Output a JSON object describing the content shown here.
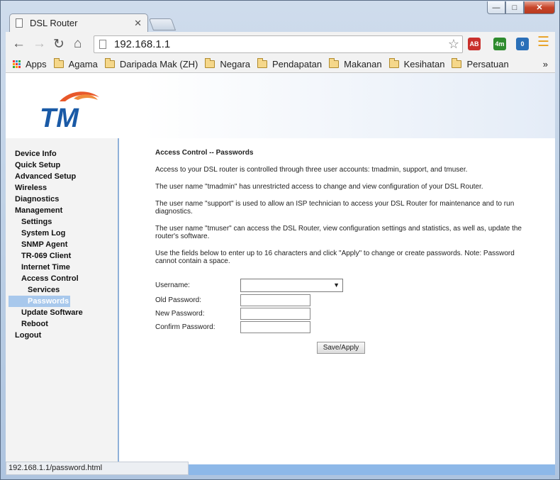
{
  "browser": {
    "tab_title": "DSL Router",
    "url": "192.168.1.1",
    "bookmarks": [
      "Apps",
      "Agama",
      "Daripada Mak (ZH)",
      "Negara",
      "Pendapatan",
      "Makanan",
      "Kesihatan",
      "Persatuan"
    ],
    "overflow": "»",
    "status_url": "192.168.1.1/password.html",
    "extensions": [
      {
        "name": "adblock-icon",
        "label": "AB",
        "color": "#c9302c"
      },
      {
        "name": "weather-extension-icon",
        "label": "4m",
        "color": "#2e8b2e"
      },
      {
        "name": "ghostery-icon",
        "label": "0",
        "color": "#2a6fb8"
      }
    ]
  },
  "router": {
    "logo_text": "TM",
    "sidebar": [
      {
        "label": "Device Info",
        "level": 1
      },
      {
        "label": "Quick Setup",
        "level": 1
      },
      {
        "label": "Advanced Setup",
        "level": 1
      },
      {
        "label": "Wireless",
        "level": 1
      },
      {
        "label": "Diagnostics",
        "level": 1
      },
      {
        "label": "Management",
        "level": 1
      },
      {
        "label": "Settings",
        "level": 2
      },
      {
        "label": "System Log",
        "level": 2
      },
      {
        "label": "SNMP Agent",
        "level": 2
      },
      {
        "label": "TR-069 Client",
        "level": 2
      },
      {
        "label": "Internet Time",
        "level": 2
      },
      {
        "label": "Access Control",
        "level": 2
      },
      {
        "label": "Services",
        "level": 3
      },
      {
        "label": "Passwords",
        "level": 3,
        "active": true
      },
      {
        "label": "Update Software",
        "level": 2
      },
      {
        "label": "Reboot",
        "level": 2
      },
      {
        "label": "Logout",
        "level": 1
      }
    ],
    "page": {
      "title": "Access Control -- Passwords",
      "paragraphs": [
        "Access to your DSL router is controlled through three user accounts: tmadmin, support, and tmuser.",
        "The user name \"tmadmin\" has unrestricted access to change and view configuration of your DSL Router.",
        "The user name \"support\" is used to allow an ISP technician to access your DSL Router for maintenance and to run diagnostics.",
        "The user name \"tmuser\" can access the DSL Router, view configuration settings and statistics, as well as, update the router's software.",
        "Use the fields below to enter up to 16 characters and click \"Apply\" to change or create passwords. Note: Password cannot contain a space."
      ],
      "form": {
        "username_label": "Username:",
        "username_value": "",
        "old_password_label": "Old Password:",
        "new_password_label": "New Password:",
        "confirm_password_label": "Confirm Password:",
        "apply_button": "Save/Apply"
      }
    }
  }
}
